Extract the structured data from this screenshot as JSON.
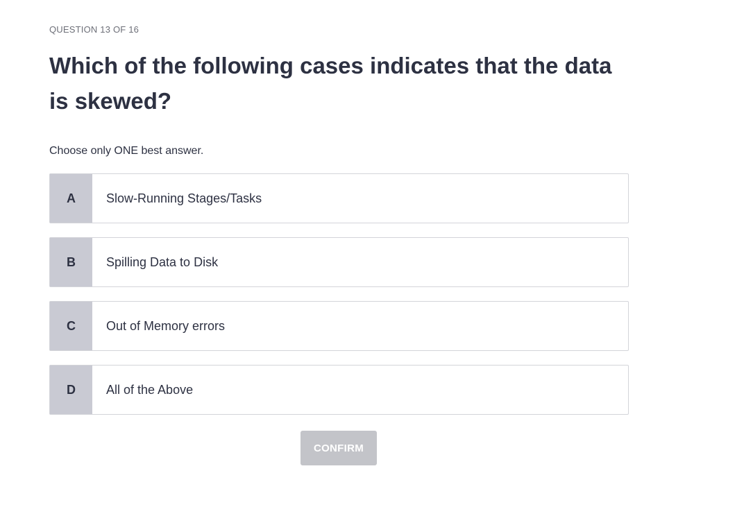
{
  "quiz": {
    "progress": "QUESTION 13 OF 16",
    "question": "Which of the following cases indicates that the data is skewed?",
    "instruction": "Choose only ONE best answer.",
    "options": [
      {
        "letter": "A",
        "text": "Slow-Running Stages/Tasks"
      },
      {
        "letter": "B",
        "text": "Spilling Data to Disk"
      },
      {
        "letter": "C",
        "text": "Out of Memory errors"
      },
      {
        "letter": "D",
        "text": "All of the Above"
      }
    ],
    "confirm_label": "CONFIRM"
  },
  "colors": {
    "letter_bg": "#c9cad3",
    "text": "#2d3142",
    "confirm_disabled_bg": "#c3c4c9",
    "border": "#d3d4d9"
  }
}
